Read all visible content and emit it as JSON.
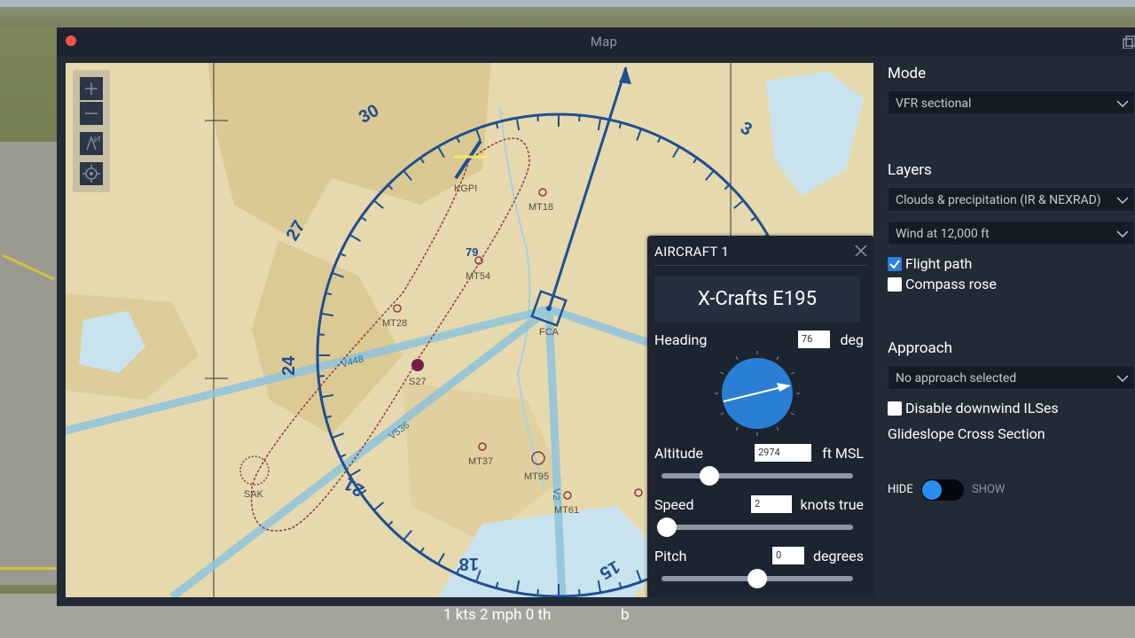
{
  "window": {
    "title": "Map"
  },
  "map": {
    "compass_labels": [
      "30",
      "3",
      "27",
      "24",
      "21",
      "18",
      "15"
    ],
    "airports": [
      {
        "id": "KGPI"
      },
      {
        "id": "MT18"
      },
      {
        "id": "MT54"
      },
      {
        "id": "MT28"
      },
      {
        "id": "S27"
      },
      {
        "id": "FCA"
      },
      {
        "id": "MT37"
      },
      {
        "id": "MT95"
      },
      {
        "id": "MT61"
      },
      {
        "id": "SAK"
      }
    ],
    "airways": [
      "V448",
      "V536",
      "V2"
    ],
    "elevation_label": "79",
    "zoom_in_icon": "plus-icon",
    "zoom_out_icon": "minus-icon",
    "north_up_icon": "north-arrow-icon",
    "center_icon": "crosshair-icon"
  },
  "aircraft_panel": {
    "header": "AIRCRAFT 1",
    "name": "X-Crafts E195",
    "heading_label": "Heading",
    "heading_value": "76",
    "heading_unit": "deg",
    "altitude_label": "Altitude",
    "altitude_value": "2974",
    "altitude_unit": "ft MSL",
    "altitude_slider_fraction": 0.25,
    "speed_label": "Speed",
    "speed_value": "2",
    "speed_unit": "knots true",
    "speed_slider_fraction": 0.03,
    "pitch_label": "Pitch",
    "pitch_value": "0",
    "pitch_unit": "degrees",
    "pitch_slider_fraction": 0.5
  },
  "sidebar": {
    "mode_label": "Mode",
    "mode_value": "VFR sectional",
    "layers_label": "Layers",
    "layer1_value": "Clouds & precipitation (IR & NEXRAD)",
    "layer2_value": "Wind at 12,000 ft",
    "flight_path_label": "Flight path",
    "flight_path_checked": true,
    "compass_rose_label": "Compass rose",
    "compass_rose_checked": false,
    "approach_label": "Approach",
    "approach_value": "No approach selected",
    "downwind_label": "Disable downwind ILSes",
    "glideslope_label": "Glideslope Cross Section",
    "toggle_hide": "HIDE",
    "toggle_show": "SHOW"
  },
  "status": {
    "text": "1 kts   2 mph 0 th",
    "text2": "b"
  },
  "colors": {
    "accent": "#2a8ef0",
    "compass": "#1f4f8f",
    "map_bg": "#e8dcb2",
    "water": "#c9e3ee",
    "panel": "#1c2430"
  }
}
